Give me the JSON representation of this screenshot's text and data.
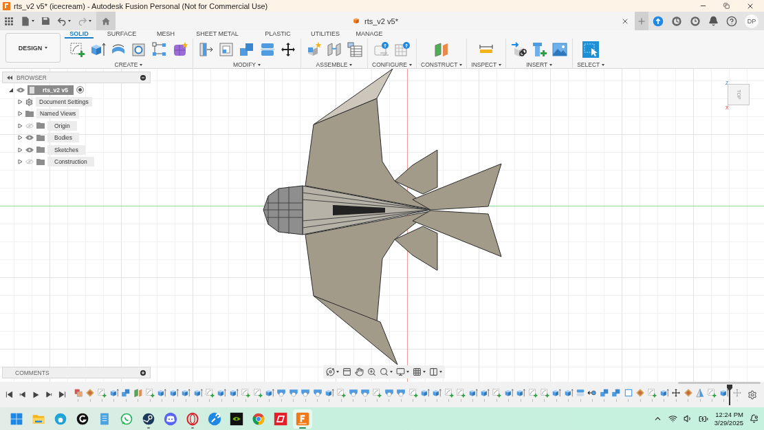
{
  "window": {
    "title": "rts_v2 v5* (icecream) - Autodesk Fusion Personal (Not for Commercial Use)"
  },
  "document_tab": {
    "label": "rts_v2 v5*"
  },
  "user": {
    "initials": "DP"
  },
  "workspace": {
    "label": "DESIGN"
  },
  "ribbon_tabs": [
    {
      "label": "SOLID",
      "selected": true
    },
    {
      "label": "SURFACE",
      "selected": false
    },
    {
      "label": "MESH",
      "selected": false
    },
    {
      "label": "SHEET METAL",
      "selected": false
    },
    {
      "label": "PLASTIC",
      "selected": false
    },
    {
      "label": "UTILITIES",
      "selected": false
    },
    {
      "label": "MANAGE",
      "selected": false
    }
  ],
  "tool_groups": [
    {
      "label": "CREATE",
      "tools": [
        {
          "kind": "sketch"
        },
        {
          "kind": "extrude"
        },
        {
          "kind": "revolve"
        },
        {
          "kind": "hole"
        },
        {
          "kind": "pattern"
        },
        {
          "kind": "form"
        }
      ]
    },
    {
      "label": "MODIFY",
      "tools": [
        {
          "kind": "presspull"
        },
        {
          "kind": "shell"
        },
        {
          "kind": "combine"
        },
        {
          "kind": "split"
        },
        {
          "kind": "move"
        }
      ]
    },
    {
      "label": "ASSEMBLE",
      "tools": [
        {
          "kind": "newcomponent"
        },
        {
          "kind": "joint"
        },
        {
          "kind": "table"
        }
      ]
    },
    {
      "label": "CONFIGURE",
      "tools": [
        {
          "kind": "params"
        },
        {
          "kind": "configtable"
        }
      ]
    },
    {
      "label": "CONSTRUCT",
      "tools": [
        {
          "kind": "plane"
        }
      ]
    },
    {
      "label": "INSPECT",
      "tools": [
        {
          "kind": "measure"
        }
      ]
    },
    {
      "label": "INSERT",
      "tools": [
        {
          "kind": "insertlink"
        },
        {
          "kind": "bolt"
        },
        {
          "kind": "image"
        }
      ]
    },
    {
      "label": "SELECT",
      "tools": [
        {
          "kind": "select"
        }
      ]
    }
  ],
  "browser": {
    "title": "BROWSER",
    "root": {
      "label": "rts_v2 v5",
      "expanded": true,
      "visible": true,
      "children": [
        {
          "kind": "settings",
          "label": "Document Settings",
          "expanded": false
        },
        {
          "kind": "views",
          "label": "Named Views",
          "expanded": false
        },
        {
          "kind": "folder",
          "label": "Origin",
          "expanded": false,
          "visible": false
        },
        {
          "kind": "folder",
          "label": "Bodies",
          "expanded": false,
          "visible": true
        },
        {
          "kind": "folder",
          "label": "Sketches",
          "expanded": false,
          "visible": true
        },
        {
          "kind": "folder",
          "label": "Construction",
          "expanded": false,
          "visible": false
        }
      ]
    }
  },
  "view_cube": {
    "face": "TOP",
    "axes": [
      "Z",
      "X"
    ]
  },
  "comments": {
    "title": "COMMENTS"
  },
  "timeline": [
    {
      "kind": "component",
      "rolled_back": false
    },
    {
      "kind": "canvas",
      "rolled_back": false
    },
    {
      "kind": "sketch",
      "rolled_back": false
    },
    {
      "kind": "extrude",
      "rolled_back": false
    },
    {
      "kind": "combine",
      "rolled_back": false
    },
    {
      "kind": "plane",
      "rolled_back": false
    },
    {
      "kind": "sketch",
      "rolled_back": false
    },
    {
      "kind": "extrude",
      "rolled_back": false
    },
    {
      "kind": "extrude",
      "rolled_back": false
    },
    {
      "kind": "extrude",
      "rolled_back": false
    },
    {
      "kind": "extrude",
      "rolled_back": false
    },
    {
      "kind": "sketch",
      "rolled_back": false
    },
    {
      "kind": "extrude",
      "rolled_back": false
    },
    {
      "kind": "extrude",
      "rolled_back": false
    },
    {
      "kind": "sketch",
      "rolled_back": false
    },
    {
      "kind": "sketch",
      "rolled_back": false
    },
    {
      "kind": "extrude",
      "rolled_back": false
    },
    {
      "kind": "loft",
      "rolled_back": false
    },
    {
      "kind": "loft",
      "rolled_back": false
    },
    {
      "kind": "loft",
      "rolled_back": false
    },
    {
      "kind": "loft",
      "rolled_back": false
    },
    {
      "kind": "extrude",
      "rolled_back": false
    },
    {
      "kind": "sketch",
      "rolled_back": false
    },
    {
      "kind": "loft",
      "rolled_back": false
    },
    {
      "kind": "loft",
      "rolled_back": false
    },
    {
      "kind": "sketch",
      "rolled_back": false
    },
    {
      "kind": "loft",
      "rolled_back": false
    },
    {
      "kind": "loft",
      "rolled_back": false
    },
    {
      "kind": "sketch",
      "rolled_back": false
    },
    {
      "kind": "extrude",
      "rolled_back": false
    },
    {
      "kind": "extrude",
      "rolled_back": false
    },
    {
      "kind": "sketch",
      "rolled_back": false
    },
    {
      "kind": "sketch",
      "rolled_back": false
    },
    {
      "kind": "extrude",
      "rolled_back": false
    },
    {
      "kind": "extrude",
      "rolled_back": false
    },
    {
      "kind": "sketch",
      "rolled_back": false
    },
    {
      "kind": "extrude",
      "rolled_back": false
    },
    {
      "kind": "extrude",
      "rolled_back": false
    },
    {
      "kind": "sketch",
      "rolled_back": false
    },
    {
      "kind": "sketch",
      "rolled_back": false
    },
    {
      "kind": "extrude",
      "rolled_back": false
    },
    {
      "kind": "extrude",
      "rolled_back": false
    },
    {
      "kind": "split",
      "rolled_back": false
    },
    {
      "kind": "joint",
      "rolled_back": false
    },
    {
      "kind": "combine",
      "rolled_back": false
    },
    {
      "kind": "combine",
      "rolled_back": false
    },
    {
      "kind": "shell",
      "rolled_back": false
    },
    {
      "kind": "canvas",
      "rolled_back": false
    },
    {
      "kind": "sketch",
      "rolled_back": false
    },
    {
      "kind": "extrude",
      "rolled_back": false
    },
    {
      "kind": "move",
      "rolled_back": false
    },
    {
      "kind": "canvas",
      "rolled_back": false
    },
    {
      "kind": "mirror",
      "rolled_back": false
    },
    {
      "kind": "sketch",
      "rolled_back": false
    },
    {
      "kind": "extrude",
      "rolled_back": false
    },
    {
      "kind": "move",
      "rolled_back": true
    }
  ],
  "taskbar": [
    {
      "kind": "start",
      "running": false,
      "selected": false
    },
    {
      "kind": "folder",
      "running": false,
      "selected": false
    },
    {
      "kind": "edge",
      "running": false,
      "selected": false
    },
    {
      "kind": "ghub",
      "running": false,
      "selected": false
    },
    {
      "kind": "notepad",
      "running": false,
      "selected": false
    },
    {
      "kind": "whatsapp",
      "running": false,
      "selected": false
    },
    {
      "kind": "steam",
      "running": true,
      "selected": false
    },
    {
      "kind": "discord",
      "running": false,
      "selected": false
    },
    {
      "kind": "opera",
      "running": true,
      "selected": false
    },
    {
      "kind": "wrench",
      "running": false,
      "selected": false
    },
    {
      "kind": "nvidia",
      "running": false,
      "selected": false
    },
    {
      "kind": "chrome",
      "running": false,
      "selected": false
    },
    {
      "kind": "redapp",
      "running": false,
      "selected": false
    },
    {
      "kind": "fusion",
      "running": true,
      "selected": true
    }
  ],
  "clock": {
    "time": "12:24 PM",
    "date": "3/29/2025"
  }
}
